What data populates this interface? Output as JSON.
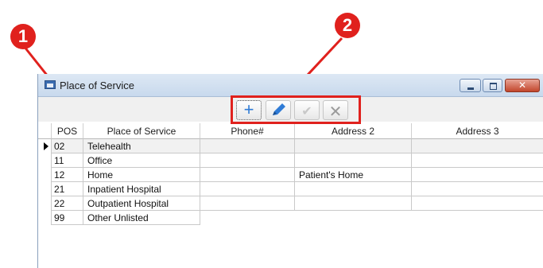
{
  "window": {
    "title": "Place of Service"
  },
  "callouts": [
    "1",
    "2"
  ],
  "toolbar": {
    "add_icon": "plus-icon",
    "edit_icon": "pencil-icon",
    "save_icon": "checkmark-icon",
    "cancel_icon": "x-icon"
  },
  "table": {
    "columns": [
      "POS",
      "Place of Service",
      "Phone#",
      "Address 2",
      "Address 3"
    ],
    "rows": [
      [
        "02",
        "Telehealth",
        "",
        "",
        ""
      ],
      [
        "11",
        "Office",
        "",
        "",
        ""
      ],
      [
        "12",
        "Home",
        "",
        "Patient's Home",
        ""
      ],
      [
        "21",
        "Inpatient Hospital",
        "",
        "",
        ""
      ],
      [
        "22",
        "Outpatient Hospital",
        "",
        "",
        ""
      ],
      [
        "99",
        "Other Unlisted",
        "",
        "",
        ""
      ]
    ]
  },
  "colors": {
    "callout": "#e0211d",
    "add_icon": "#2f7bd6",
    "edit_icon": "#2f7bd6"
  }
}
